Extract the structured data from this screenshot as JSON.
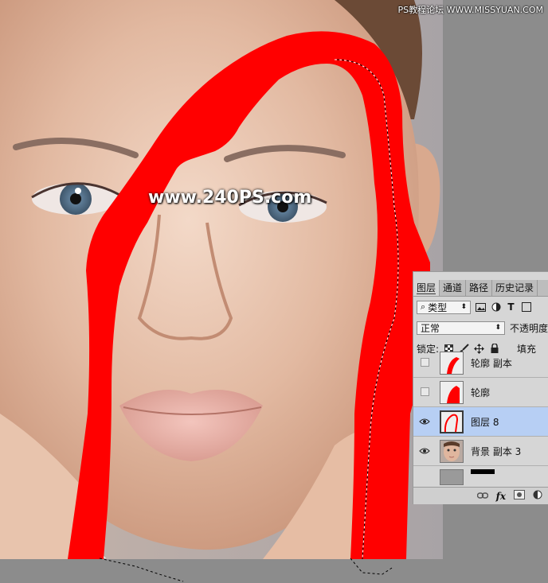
{
  "watermark": {
    "top": "PS教程论坛 WWW.MISSYUAN.COM",
    "center": "www.240PS.com"
  },
  "layers_panel": {
    "tabs": [
      "图层",
      "通道",
      "路径",
      "历史记录"
    ],
    "filter_kind": "类型",
    "blend_mode": "正常",
    "opacity_label": "不透明度",
    "lock_label": "锁定:",
    "fill_label": "填充",
    "layers": [
      {
        "name": "轮廓 副本",
        "visible": false,
        "selected": false
      },
      {
        "name": "轮廓",
        "visible": false,
        "selected": false
      },
      {
        "name": "图层 8",
        "visible": true,
        "selected": true
      },
      {
        "name": "背景 副本 3",
        "visible": true,
        "selected": false
      }
    ],
    "bottom_icons": [
      "link-icon",
      "fx-icon",
      "mask-icon",
      "adjustment-icon"
    ],
    "fx_label": "fx"
  },
  "colors": {
    "stroke_red": "#ff0000",
    "selection_bg": "#b7cff4",
    "panel_bg": "#d6d6d6"
  }
}
